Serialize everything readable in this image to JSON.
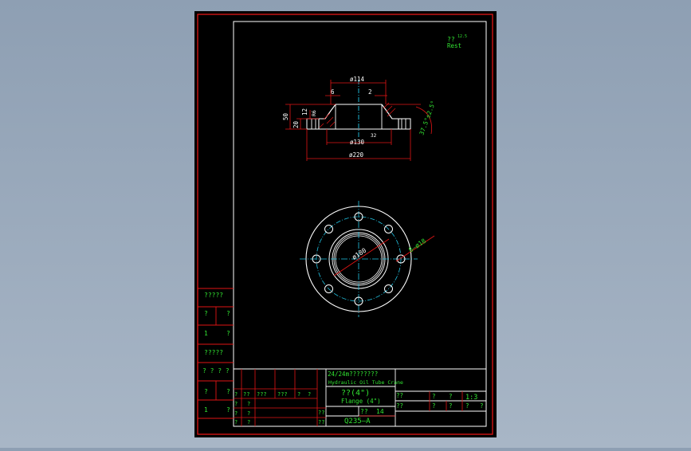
{
  "colors": {
    "background": "#97a7ba",
    "paper": "#000000",
    "frame": "#e01515",
    "outline": "#ffffff",
    "text": "#31e331",
    "dimension": "#e01515",
    "centerline": "#22c6e6"
  },
  "notes": {
    "rest_q": "??",
    "rest_sup": "12.5",
    "rest_label": "Rest"
  },
  "dimensions": {
    "d114": "ø114",
    "six": "6",
    "two": "2",
    "fifty": "50",
    "twenty": "20",
    "twelve": "12",
    "r6": "R6",
    "d130": "ø130",
    "thirty_two": "32",
    "d220": "ø220",
    "chamfer": "37.5°±2.5°",
    "d180": "ø180",
    "holes": "8–ø18"
  },
  "revision_block": {
    "rows": [
      [
        "?????"
      ],
      [
        "?",
        "?"
      ],
      [
        "1",
        "?"
      ],
      [
        "?????"
      ],
      [
        "? ? ? ?"
      ],
      [
        "?",
        "?"
      ],
      [
        "1",
        "?"
      ]
    ]
  },
  "title_block": {
    "project_cn": "24/24m????????",
    "project_en": "Hydraulic Oil Tube Crane",
    "part_cn": "??(4\")",
    "part_en": "Flange (4\")",
    "material": "Q235–A",
    "qty_q": "??",
    "qty_val": "14",
    "scale": "1:3",
    "q": "?",
    "qq": "??",
    "qqq": "???"
  }
}
